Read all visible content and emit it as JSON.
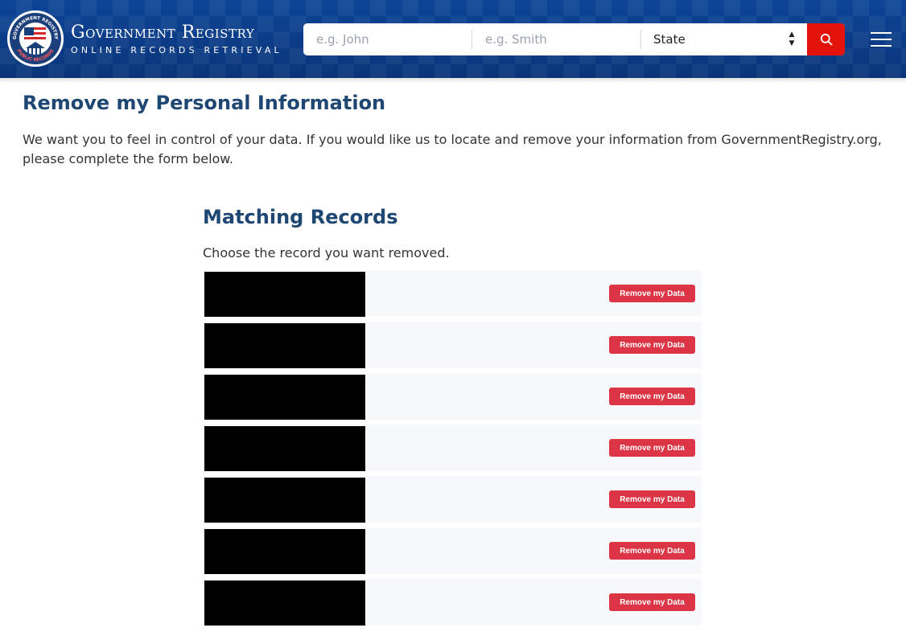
{
  "header": {
    "brand_title": "Government Registry",
    "brand_subtitle": "ONLINE RECORDS RETRIEVAL",
    "seal_text_top": "GOVERNMENT REGISTRY",
    "seal_text_bottom": "PUBLIC RECORDS",
    "search": {
      "first_name_placeholder": "e.g. John",
      "last_name_placeholder": "e.g. Smith",
      "state_value": "State"
    },
    "icons": {
      "search": "search-icon",
      "menu": "hamburger-menu-icon",
      "state_arrows": "sort-arrows-icon"
    },
    "colors": {
      "header_bg": "#0b3a84",
      "search_button": "#e3120b"
    }
  },
  "main": {
    "title": "Remove my Personal Information",
    "intro": "We want you to feel in control of your data. If you would like us to locate and remove your information from GovernmentRegistry.org, please complete the form below.",
    "section_title": "Matching Records",
    "instruction": "Choose the record you want removed.",
    "records": [
      {
        "button_label": "Remove my Data"
      },
      {
        "button_label": "Remove my Data"
      },
      {
        "button_label": "Remove my Data"
      },
      {
        "button_label": "Remove my Data"
      },
      {
        "button_label": "Remove my Data"
      },
      {
        "button_label": "Remove my Data"
      },
      {
        "button_label": "Remove my Data"
      }
    ],
    "colors": {
      "heading": "#1f4773",
      "remove_button": "#dc3545",
      "row_bg": "#f7f8fa"
    }
  }
}
